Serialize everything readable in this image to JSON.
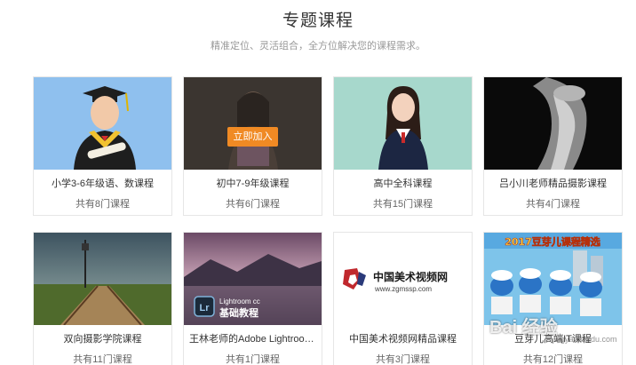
{
  "header": {
    "title": "专题课程",
    "subtitle": "精准定位、灵活组合，全方位解决您的课程需求。"
  },
  "courses": [
    {
      "name": "小学3-6年级语、数课程",
      "count": "共有8门课程"
    },
    {
      "name": "初中7-9年级课程",
      "count": "共有6门课程",
      "action": "立即加入"
    },
    {
      "name": "高中全科课程",
      "count": "共有15门课程"
    },
    {
      "name": "吕小川老师精品摄影课程",
      "count": "共有4门课程"
    },
    {
      "name": "双向摄影学院课程",
      "count": "共有11门课程"
    },
    {
      "name": "王林老师的Adobe Lightroom ...",
      "count": "共有1门课程",
      "image_text": {
        "product": "Lightroom cc",
        "title": "基础教程",
        "icon": "Lr"
      }
    },
    {
      "name": "中国美术视频网精品课程",
      "count": "共有3门课程",
      "image_text": {
        "brand": "中国美术视频网",
        "url": "www.zgmssp.com"
      }
    },
    {
      "name": "豆芽儿高端IT课程",
      "count": "共有12门课程",
      "image_text": {
        "banner": "2017豆芽儿课程精选"
      }
    }
  ],
  "watermark": {
    "logo": "Bai 经验",
    "url": "jingyan.baidu.com"
  },
  "colors": {
    "accent": "#f08a24",
    "border": "#e6e6e6"
  }
}
